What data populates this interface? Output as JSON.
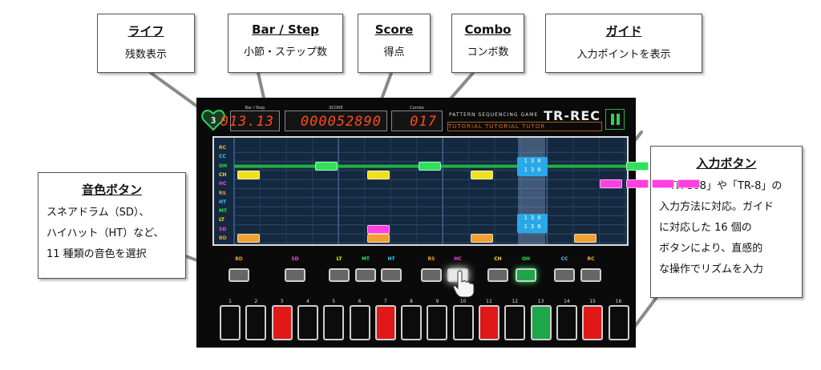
{
  "callouts": {
    "life": {
      "title": "ライフ",
      "desc": "残数表示"
    },
    "bar_step": {
      "title": "Bar / Step",
      "desc": "小節・ステップ数"
    },
    "score": {
      "title": "Score",
      "desc": "得点"
    },
    "combo": {
      "title": "Combo",
      "desc": "コンボ数"
    },
    "guide": {
      "title": "ガイド",
      "desc": "入力ポイントを表示"
    },
    "sound": {
      "title": "音色ボタン",
      "lines": [
        "スネアドラム（SD）、",
        "ハイハット（HT）など、",
        "11 種類の音色を選択"
      ]
    },
    "input": {
      "title": "入力ボタン",
      "lines": [
        "「TR-808」や「TR-8」の",
        "入力方法に対応。ガイド",
        "に対応した 16 個の",
        "ボタンにより、直感的",
        "な操作でリズムを入力"
      ]
    }
  },
  "game": {
    "life_value": "3",
    "bar_step_label": "Bar / Step",
    "bar_step_value": "013.13",
    "score_label": "SCORE",
    "score_value": "000052890",
    "combo_label": "Combo",
    "combo_value": "017",
    "subtitle": "PATTERN SEQUENCING GAME",
    "logo": "TR-REC",
    "tutorial_text": "TUTORIAL    TUTORIAL    TUTOR",
    "guide_counter_top": [
      "1 3 0",
      "1 3 0"
    ],
    "guide_counter_bottom": [
      "1 3 0",
      "1 3 0"
    ]
  },
  "rows": [
    {
      "label": "RC",
      "color": "#f0b040"
    },
    {
      "label": "CC",
      "color": "#40c8f0"
    },
    {
      "label": "OH",
      "color": "#2ee05a"
    },
    {
      "label": "CH",
      "color": "#f0e020"
    },
    {
      "label": "HC",
      "color": "#ff40e0"
    },
    {
      "label": "RS",
      "color": "#f0a030"
    },
    {
      "label": "HT",
      "color": "#30d0f0"
    },
    {
      "label": "MT",
      "color": "#2ee05a"
    },
    {
      "label": "LT",
      "color": "#e8e820"
    },
    {
      "label": "SD",
      "color": "#ff40e0"
    },
    {
      "label": "BD",
      "color": "#f0a030"
    }
  ],
  "sound_buttons": [
    {
      "label": "BD",
      "color": "#f0a030"
    },
    {
      "label": "SD",
      "color": "#ff40e0"
    },
    {
      "label": "LT",
      "color": "#e8e820"
    },
    {
      "label": "MT",
      "color": "#2ee05a"
    },
    {
      "label": "HT",
      "color": "#30d0f0"
    },
    {
      "label": "RS",
      "color": "#f0a030"
    },
    {
      "label": "HC",
      "color": "#ff40e0"
    },
    {
      "label": "CH",
      "color": "#f0e020"
    },
    {
      "label": "OH",
      "color": "#2ee05a"
    },
    {
      "label": "CC",
      "color": "#40c8f0"
    },
    {
      "label": "RC",
      "color": "#f0b040"
    }
  ],
  "steps": [
    {
      "num": "1",
      "state": "off"
    },
    {
      "num": "2",
      "state": "off"
    },
    {
      "num": "3",
      "state": "red"
    },
    {
      "num": "4",
      "state": "off"
    },
    {
      "num": "5",
      "state": "off"
    },
    {
      "num": "6",
      "state": "off"
    },
    {
      "num": "7",
      "state": "red"
    },
    {
      "num": "8",
      "state": "off"
    },
    {
      "num": "9",
      "state": "off"
    },
    {
      "num": "10",
      "state": "off"
    },
    {
      "num": "11",
      "state": "red"
    },
    {
      "num": "12",
      "state": "off"
    },
    {
      "num": "13",
      "state": "green"
    },
    {
      "num": "14",
      "state": "off"
    },
    {
      "num": "15",
      "state": "red"
    },
    {
      "num": "16",
      "state": "off"
    }
  ],
  "notes": [
    {
      "row": "OH",
      "step": 4,
      "color": "#2ee05a"
    },
    {
      "row": "OH",
      "step": 8,
      "color": "#2ee05a"
    },
    {
      "row": "OH",
      "step": 12,
      "color": "#2ee05a"
    },
    {
      "row": "OH",
      "step": 16,
      "color": "#2ee05a"
    },
    {
      "row": "CH",
      "step": 1,
      "color": "#f0e020"
    },
    {
      "row": "CH",
      "step": 6,
      "color": "#f0e020"
    },
    {
      "row": "CH",
      "step": 10,
      "color": "#f0e020"
    },
    {
      "row": "HC",
      "step": 15,
      "color": "#ff40e0"
    },
    {
      "row": "HC",
      "step": 16,
      "color": "#ff40e0"
    },
    {
      "row": "HC",
      "step": 17,
      "color": "#ff40e0"
    },
    {
      "row": "HC",
      "step": 18,
      "color": "#ff40e0"
    },
    {
      "row": "SD",
      "step": 6,
      "color": "#ff40e0"
    },
    {
      "row": "BD",
      "step": 1,
      "color": "#f0a030"
    },
    {
      "row": "BD",
      "step": 6,
      "color": "#f0a030"
    },
    {
      "row": "BD",
      "step": 10,
      "color": "#f0a030"
    },
    {
      "row": "BD",
      "step": 14,
      "color": "#f0a030"
    }
  ],
  "colors": {
    "accent_orange": "#ff4a1c",
    "life_green": "#2db34a",
    "active_green": "#1ea64a",
    "step_red": "#e01818"
  }
}
